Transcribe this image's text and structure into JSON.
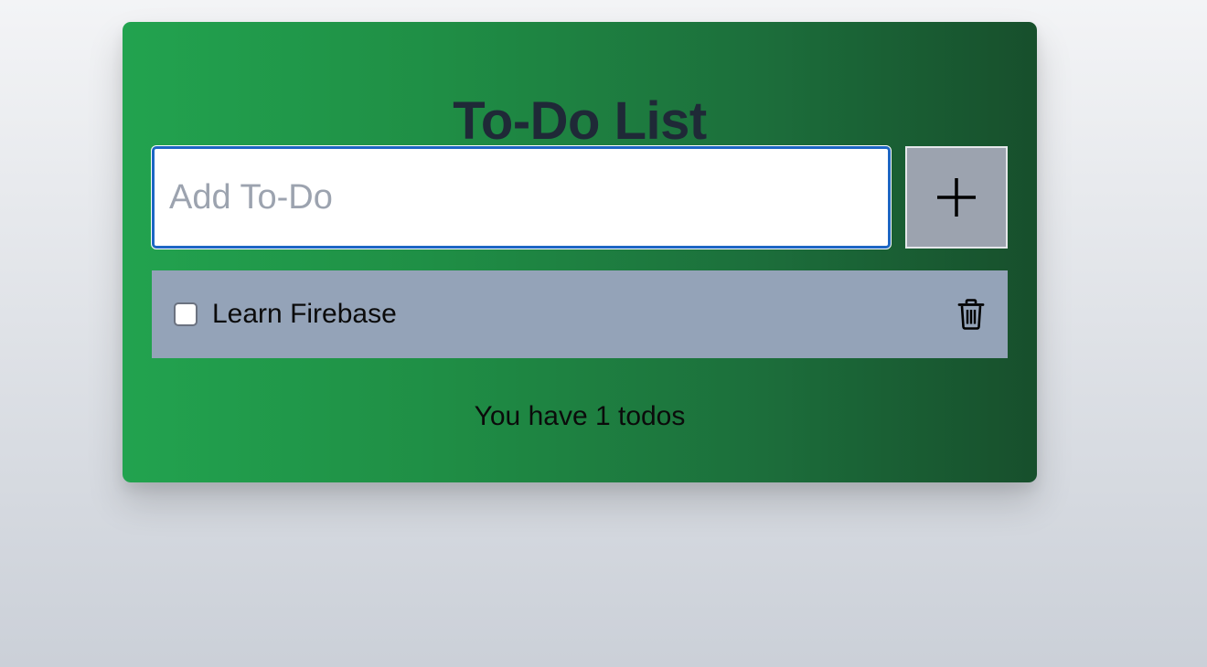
{
  "app": {
    "title": "To-Do List"
  },
  "input": {
    "placeholder": "Add To-Do",
    "value": ""
  },
  "add_button": {
    "icon": "plus-icon"
  },
  "todos": [
    {
      "text": "Learn Firebase",
      "completed": false,
      "delete_icon": "trash-icon"
    }
  ],
  "footer": {
    "count_text": "You have 1 todos"
  },
  "colors": {
    "card_gradient_start": "#22a34f",
    "card_gradient_end": "#174f2c",
    "title_color": "#1f2937",
    "input_focus_border": "#1d66c4",
    "add_button_bg": "#9ca3af",
    "todo_item_bg": "#94a3b8"
  }
}
